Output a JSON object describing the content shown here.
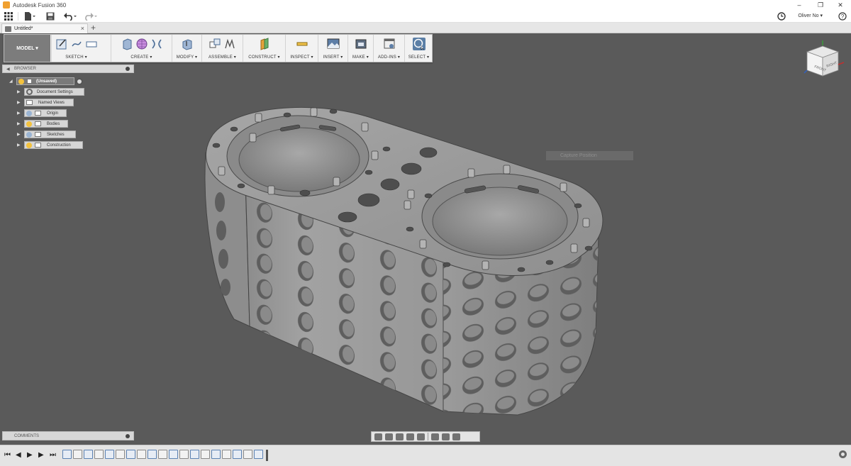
{
  "window": {
    "title": "Autodesk Fusion 360",
    "minimize_glyph": "–",
    "restore_glyph": "❐",
    "close_glyph": "✕"
  },
  "quick_access": {
    "grid_icon": "grid-icon",
    "file_icon": "file-icon",
    "save_icon": "save-icon",
    "undo_icon": "undo-icon",
    "redo_icon": "redo-icon",
    "job_status_icon": "clock-icon",
    "user_name": "Oliver No ▾"
  },
  "tabs": {
    "document_title": "Untitled*",
    "close_glyph": "×",
    "new_tab_glyph": "+"
  },
  "toolbar": {
    "workspace_label": "MODEL ▾",
    "groups": [
      {
        "label": "SKETCH ▾"
      },
      {
        "label": "CREATE ▾"
      },
      {
        "label": "MODIFY ▾"
      },
      {
        "label": "ASSEMBLE ▾"
      },
      {
        "label": "CONSTRUCT ▾"
      },
      {
        "label": "INSPECT ▾"
      },
      {
        "label": "INSERT ▾"
      },
      {
        "label": "MAKE ▾"
      },
      {
        "label": "ADD-INS ▾"
      },
      {
        "label": "SELECT ▾"
      }
    ]
  },
  "browser": {
    "header": "BROWSER",
    "root": "(Unsaved)",
    "items": [
      {
        "label": "Document Settings"
      },
      {
        "label": "Named Views"
      },
      {
        "label": "Origin"
      },
      {
        "label": "Bodies"
      },
      {
        "label": "Sketches"
      },
      {
        "label": "Construction"
      }
    ]
  },
  "comments": {
    "header": "COMMENTS"
  },
  "viewport": {
    "tooltip": "Capture Position",
    "viewcube_front": "FRONT",
    "viewcube_right": "RIGHT"
  },
  "timeline": {
    "first_glyph": "⏮",
    "prev_glyph": "◀",
    "play_glyph": "▶",
    "next_glyph": "▶",
    "last_glyph": "⏭",
    "feature_count": 19
  },
  "colors": {
    "accent_select": "#5b7fa6",
    "bulb_on": "#f3c23e",
    "viewport_bg": "#5a5a5a",
    "model_gray": "#9a9a9a"
  }
}
